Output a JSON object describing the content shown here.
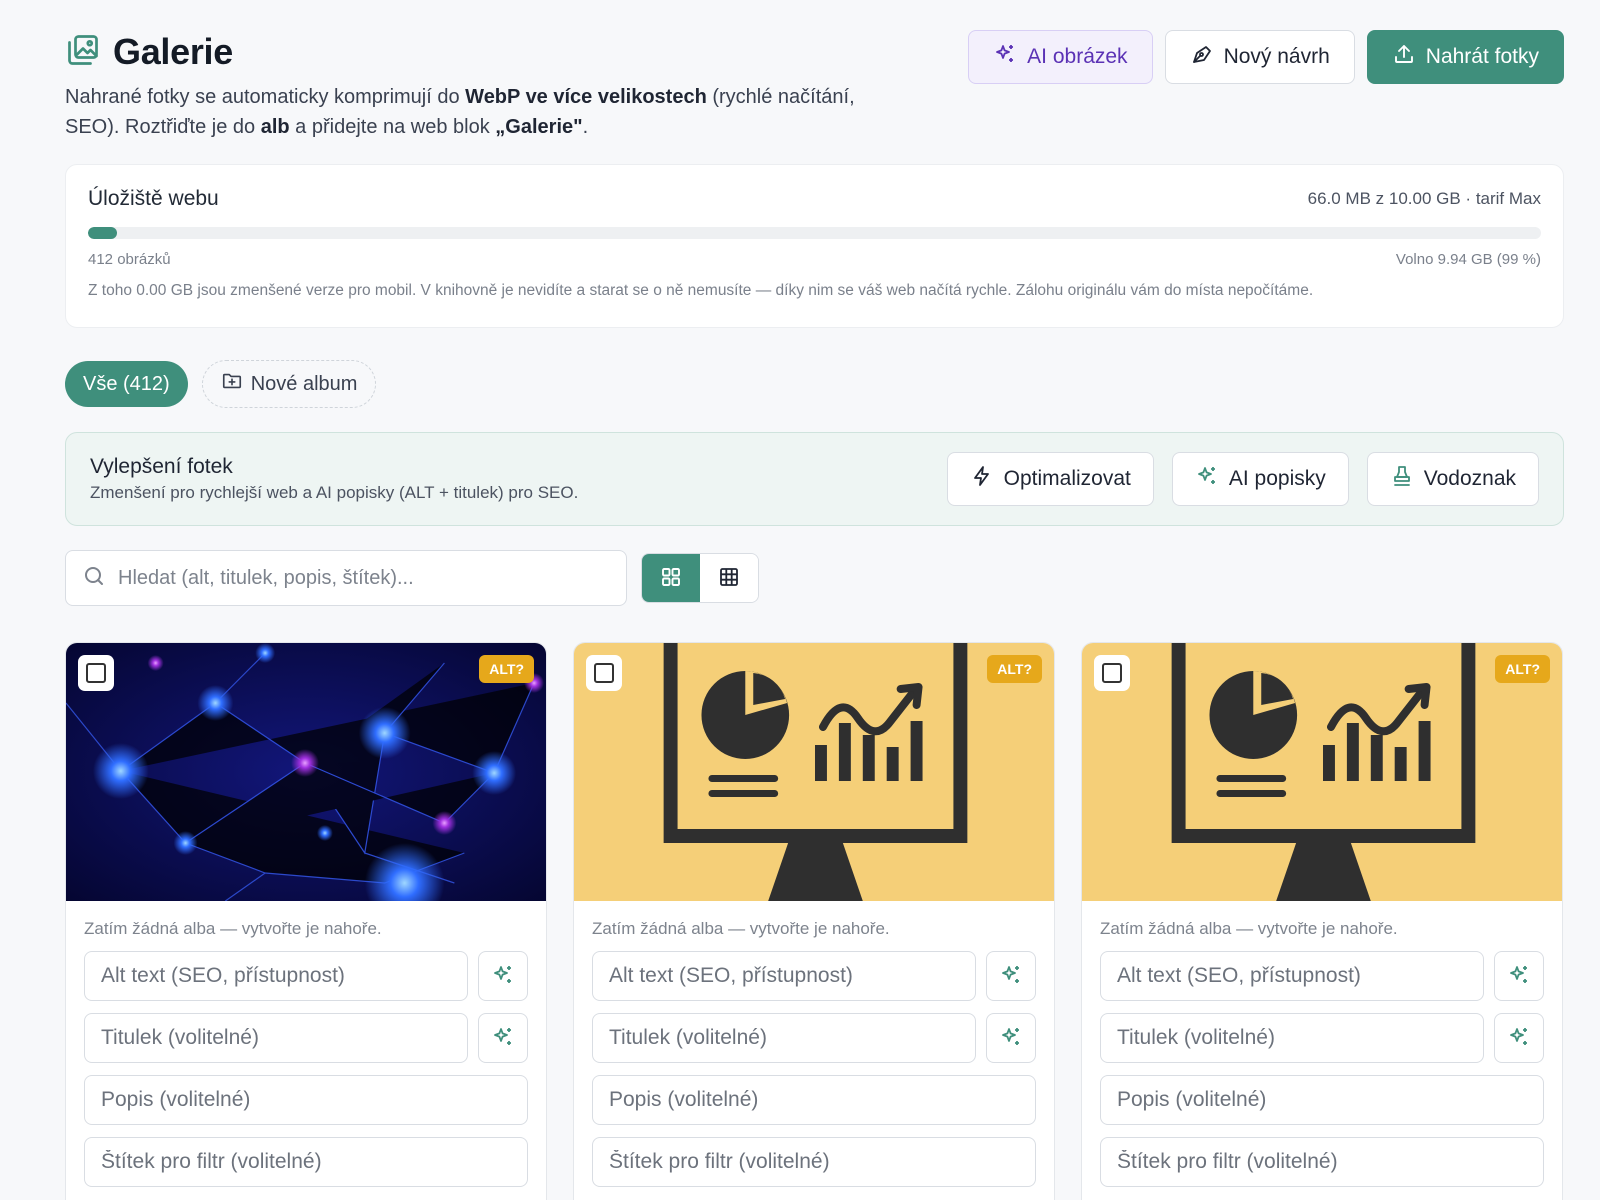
{
  "header": {
    "title": "Galerie",
    "subtitle_parts": [
      "Nahrané fotky se automaticky komprimují do ",
      "WebP ve více velikostech",
      " (rychlé načítání, SEO). Roztřiďte je do ",
      "alb",
      " a přidejte na web blok ",
      "„Galerie\"",
      "."
    ],
    "actions": {
      "ai_image": "AI obrázek",
      "new_design": "Nový návrh",
      "upload": "Nahrát fotky"
    }
  },
  "storage": {
    "title": "Úložiště webu",
    "usage": "66.0 MB z 10.00 GB · tarif Max",
    "used_fraction": 0.02,
    "image_count": "412 obrázků",
    "free": "Volno 9.94 GB (99 %)",
    "note": "Z toho 0.00 GB jsou zmenšené verze pro mobil. V knihovně je nevidíte a starat se o ně nemusíte — díky nim se váš web načítá rychle. Zálohu originálu vám do místa nepočítáme."
  },
  "albums": {
    "all": "Vše (412)",
    "new_album": "Nové album"
  },
  "enhance": {
    "title": "Vylepšení fotek",
    "description": "Zmenšení pro rychlejší web a AI popisky (ALT + titulek) pro SEO.",
    "optimize": "Optimalizovat",
    "ai_captions": "AI popisky",
    "watermark": "Vodoznak"
  },
  "search": {
    "placeholder": "Hledat (alt, titulek, popis, štítek)..."
  },
  "colors": {
    "accent": "#3f8f7c",
    "ai_purple": "#5b32b5",
    "badge": "#e6a81b",
    "presentation_bg": "#f5cf78"
  },
  "cards": [
    {
      "image": "neural-network-photo",
      "badge": "ALT?",
      "albums_hint": "Zatím žádná alba — vytvořte je nahoře.",
      "alt_placeholder": "Alt text (SEO, přístupnost)",
      "title_placeholder": "Titulek (volitelné)",
      "description_placeholder": "Popis (volitelné)",
      "tag_placeholder": "Štítek pro filtr (volitelné)"
    },
    {
      "image": "presentation-monitor-illustration",
      "badge": "ALT?",
      "albums_hint": "Zatím žádná alba — vytvořte je nahoře.",
      "alt_placeholder": "Alt text (SEO, přístupnost)",
      "title_placeholder": "Titulek (volitelné)",
      "description_placeholder": "Popis (volitelné)",
      "tag_placeholder": "Štítek pro filtr (volitelné)"
    },
    {
      "image": "presentation-monitor-illustration",
      "badge": "ALT?",
      "albums_hint": "Zatím žádná alba — vytvořte je nahoře.",
      "alt_placeholder": "Alt text (SEO, přístupnost)",
      "title_placeholder": "Titulek (volitelné)",
      "description_placeholder": "Popis (volitelné)",
      "tag_placeholder": "Štítek pro filtr (volitelné)"
    }
  ]
}
